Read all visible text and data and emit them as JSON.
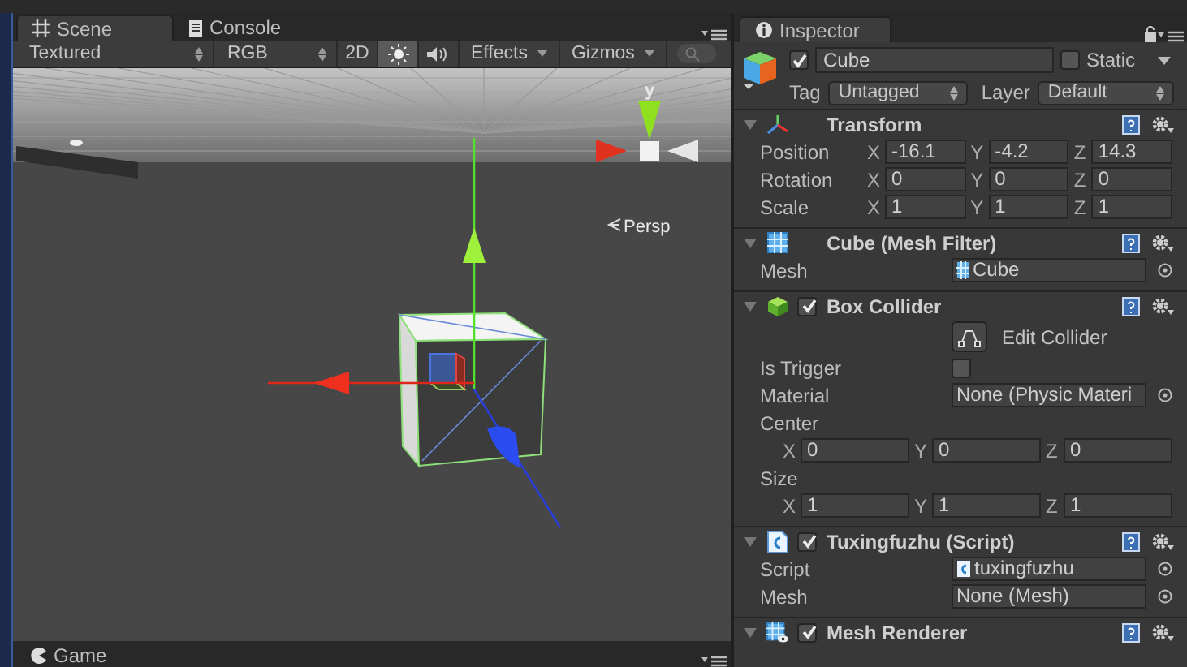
{
  "scene_tabs": [
    {
      "kind": "scene",
      "label": "Scene",
      "selected": true
    },
    {
      "kind": "console",
      "label": "Console",
      "selected": false
    }
  ],
  "scene_toolbar": {
    "items": [
      {
        "kind": "dropdown",
        "label": "Textured"
      },
      {
        "kind": "dropdown",
        "label": "RGB"
      },
      {
        "kind": "toggle",
        "label": "2D",
        "on": false
      },
      {
        "kind": "lighting_toggle",
        "on": true
      },
      {
        "kind": "audio_toggle",
        "on": false
      },
      {
        "kind": "menu",
        "label": "Effects"
      },
      {
        "kind": "menu",
        "label": "Gizmos"
      },
      {
        "kind": "search"
      }
    ]
  },
  "scene_view": {
    "axis_label": "y",
    "projection": "Persp"
  },
  "game_tab": {
    "label": "Game",
    "selected": false
  },
  "inspector": {
    "tab": {
      "label": "Inspector",
      "selected": true
    },
    "object": {
      "active": true,
      "name": "Cube",
      "static": false,
      "static_label": "Static",
      "tag_label": "Tag",
      "tag": "Untagged",
      "layer_label": "Layer",
      "layer": "Default"
    },
    "components": [
      {
        "kind": "transform",
        "title": "Transform",
        "expanded": true,
        "rows": [
          {
            "kind": "vector",
            "label": "Position",
            "fields": [
              {
                "axis": "X",
                "value": "-16.1"
              },
              {
                "axis": "Y",
                "value": "-4.2"
              },
              {
                "axis": "Z",
                "value": "14.3"
              }
            ]
          },
          {
            "kind": "vector",
            "label": "Rotation",
            "fields": [
              {
                "axis": "X",
                "value": "0"
              },
              {
                "axis": "Y",
                "value": "0"
              },
              {
                "axis": "Z",
                "value": "0"
              }
            ]
          },
          {
            "kind": "vector",
            "label": "Scale",
            "fields": [
              {
                "axis": "X",
                "value": "1"
              },
              {
                "axis": "Y",
                "value": "1"
              },
              {
                "axis": "Z",
                "value": "1"
              }
            ]
          }
        ]
      },
      {
        "kind": "mesh_filter",
        "title": "Cube (Mesh Filter)",
        "expanded": true,
        "rows": [
          {
            "kind": "mesh_object",
            "label": "Mesh",
            "value": "Cube"
          }
        ]
      },
      {
        "kind": "collider",
        "title": "Box Collider",
        "expanded": true,
        "enabled": true,
        "rows": [
          {
            "kind": "button",
            "label": "Edit Collider"
          },
          {
            "kind": "checkbox",
            "label": "Is Trigger",
            "checked": false
          },
          {
            "kind": "object",
            "label": "Material",
            "value": "None (Physic Materi"
          },
          {
            "kind": "heading",
            "label": "Center"
          },
          {
            "kind": "subvector",
            "fields": [
              {
                "axis": "X",
                "value": "0"
              },
              {
                "axis": "Y",
                "value": "0"
              },
              {
                "axis": "Z",
                "value": "0"
              }
            ]
          },
          {
            "kind": "heading",
            "label": "Size"
          },
          {
            "kind": "subvector",
            "fields": [
              {
                "axis": "X",
                "value": "1"
              },
              {
                "axis": "Y",
                "value": "1"
              },
              {
                "axis": "Z",
                "value": "1"
              }
            ]
          }
        ]
      },
      {
        "kind": "script",
        "title": "Tuxingfuzhu (Script)",
        "expanded": true,
        "enabled": true,
        "rows": [
          {
            "kind": "script_object",
            "label": "Script",
            "value": "tuxingfuzhu"
          },
          {
            "kind": "object",
            "label": "Mesh",
            "value": "None (Mesh)"
          }
        ]
      },
      {
        "kind": "renderer",
        "title": "Mesh Renderer",
        "expanded": true,
        "enabled": true
      }
    ]
  }
}
